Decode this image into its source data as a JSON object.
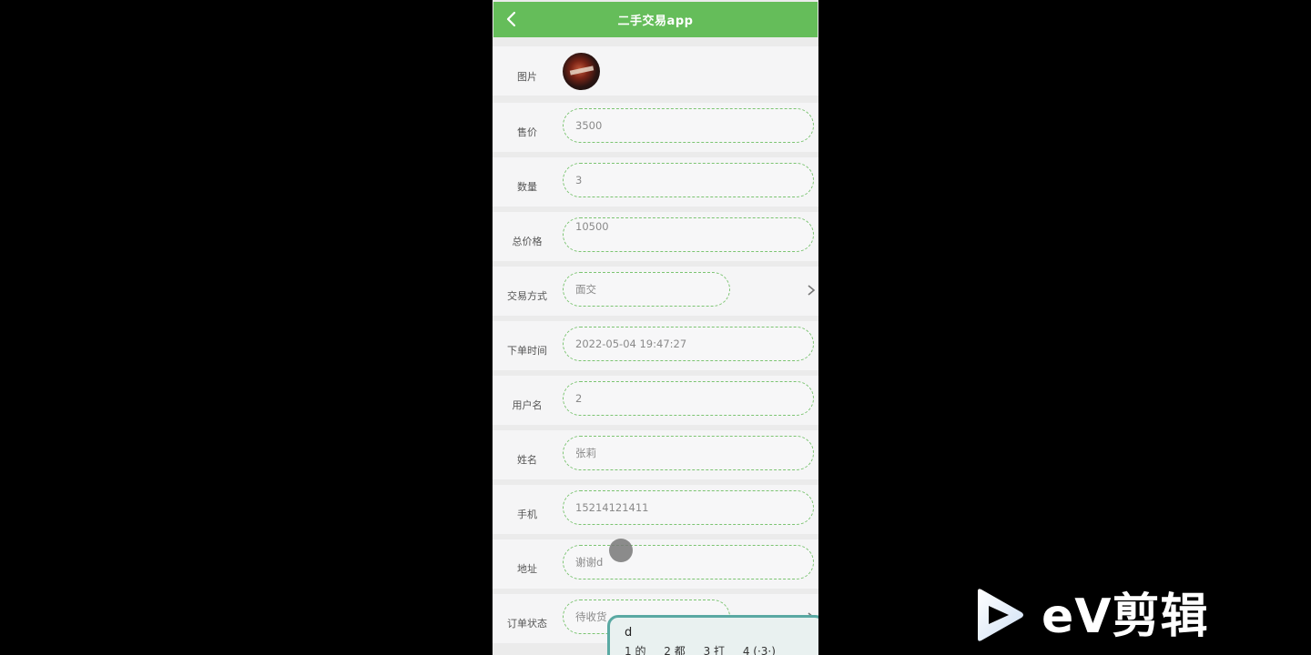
{
  "header": {
    "title": "二手交易app"
  },
  "form": {
    "image_label": "图片",
    "fields": [
      {
        "label": "售价",
        "value": "3500"
      },
      {
        "label": "数量",
        "value": "3"
      },
      {
        "label": "总价格",
        "value": "10500"
      },
      {
        "label": "交易方式",
        "value": "面交"
      },
      {
        "label": "下单时间",
        "value": "2022-05-04 19:47:27"
      },
      {
        "label": "用户名",
        "value": "2"
      },
      {
        "label": "姓名",
        "value": "张莉"
      },
      {
        "label": "手机",
        "value": "15214121411"
      },
      {
        "label": "地址",
        "value": "谢谢d"
      },
      {
        "label": "订单状态",
        "value": "待收货"
      }
    ]
  },
  "ime": {
    "composing": "d",
    "candidates": [
      "1 的",
      "2 都",
      "3 打",
      "4 (·3·)"
    ]
  },
  "watermark": {
    "text": "eV剪辑"
  },
  "colors": {
    "accent": "#65bd5a",
    "field_border": "#7cc472",
    "background": "#000000"
  },
  "icons": [
    "back-arrow-icon",
    "chevron-right-icon",
    "play-logo-icon"
  ]
}
